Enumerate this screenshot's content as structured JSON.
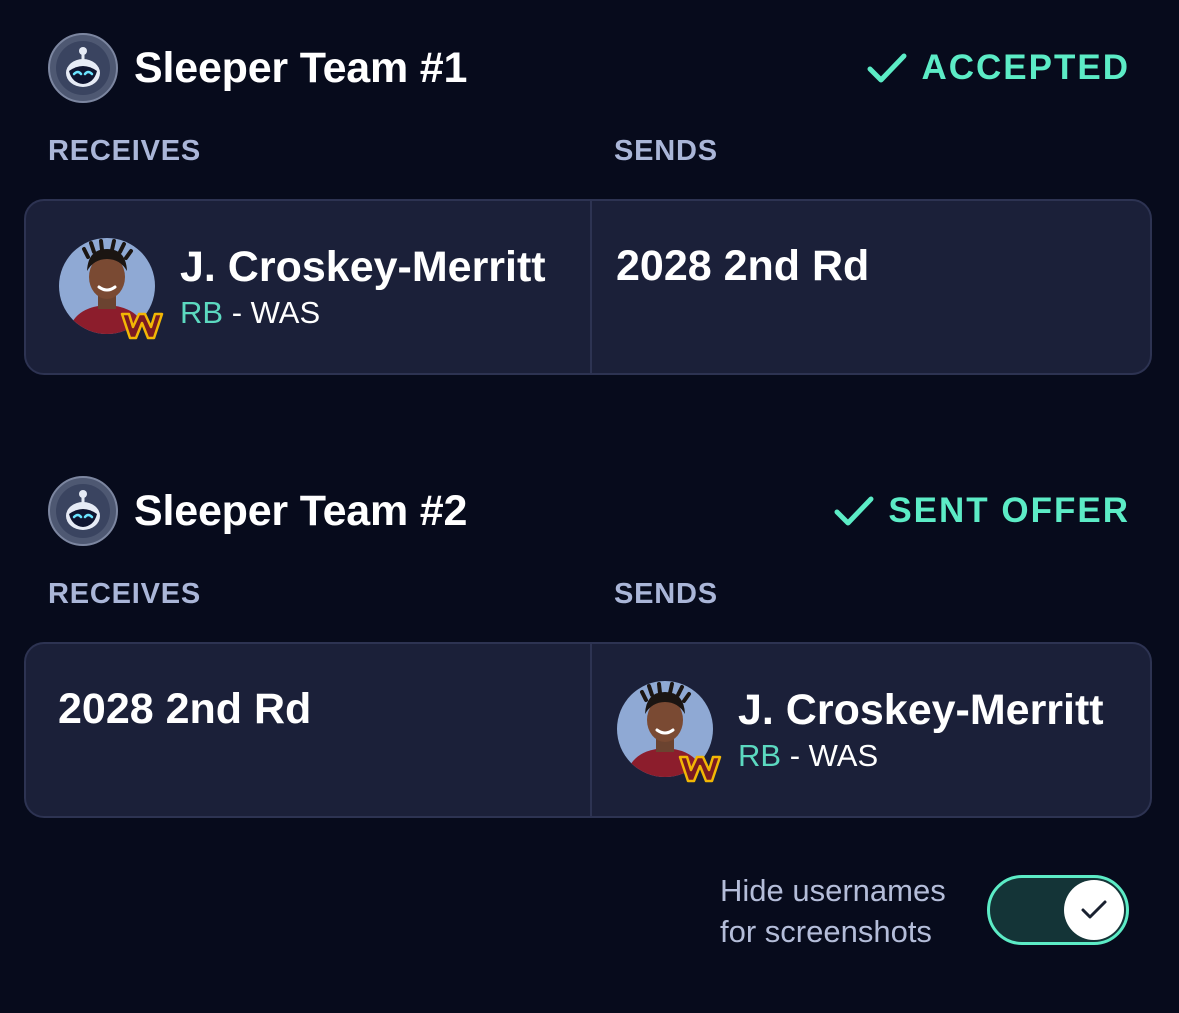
{
  "colors": {
    "background": "#070b1c",
    "card": "#1b2039",
    "accent": "#5cecc6",
    "label": "#aab6d8"
  },
  "trades": [
    {
      "team_name": "Sleeper Team #1",
      "team_icon": "sleeper-robot-avatar-icon",
      "status": "ACCEPTED",
      "status_icon": "checkmark-icon",
      "receives_label": "RECEIVES",
      "sends_label": "SENDS",
      "receives": {
        "player_name": "J. Croskey-Merritt",
        "position": "RB",
        "separator": "-",
        "nfl_team": "WAS"
      },
      "sends": {
        "pick": "2028 2nd Rd"
      }
    },
    {
      "team_name": "Sleeper Team #2",
      "team_icon": "sleeper-robot-avatar-icon",
      "status": "SENT OFFER",
      "status_icon": "checkmark-icon",
      "receives_label": "RECEIVES",
      "sends_label": "SENDS",
      "receives": {
        "pick": "2028 2nd Rd"
      },
      "sends": {
        "player_name": "J. Croskey-Merritt",
        "position": "RB",
        "separator": "-",
        "nfl_team": "WAS"
      }
    }
  ],
  "hide_usernames": {
    "label_line1": "Hide usernames",
    "label_line2": "for screenshots",
    "enabled": true
  }
}
